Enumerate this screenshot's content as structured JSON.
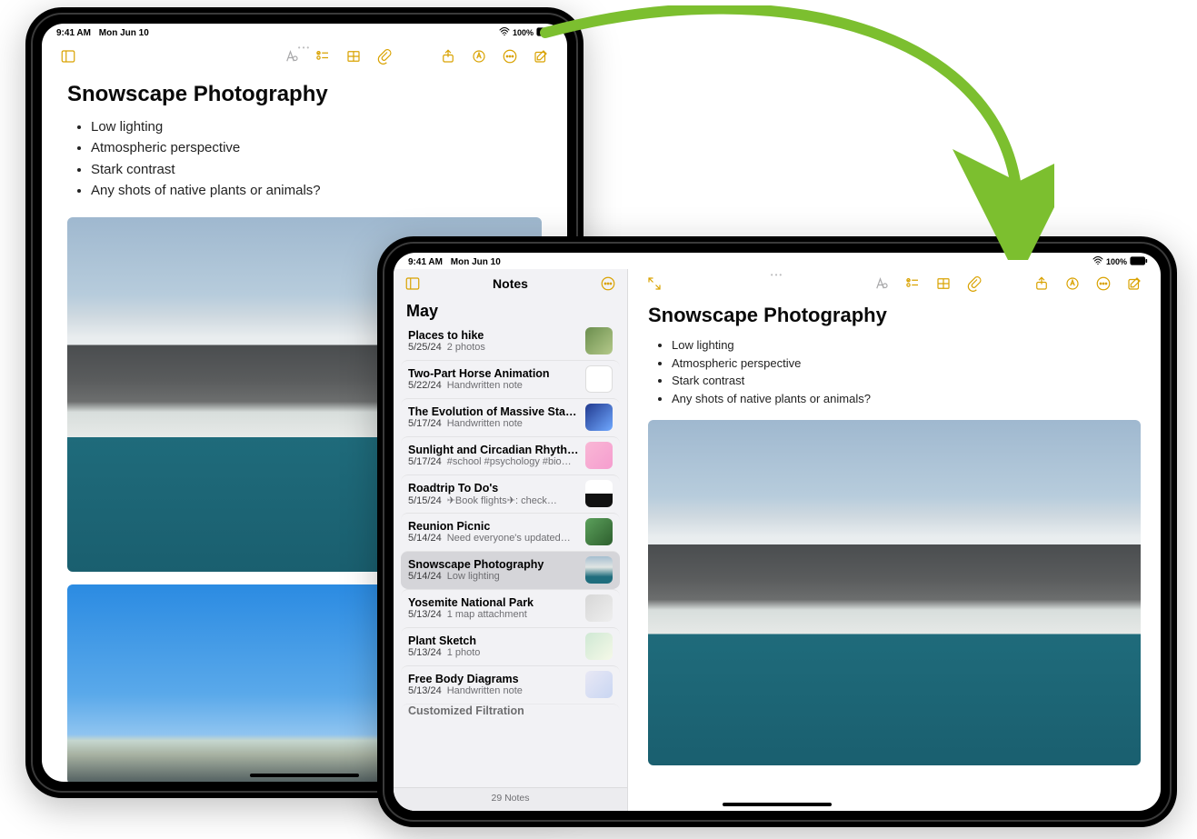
{
  "status": {
    "time": "9:41 AM",
    "date": "Mon Jun 10",
    "battery_percent": "100%"
  },
  "note": {
    "title": "Snowscape Photography",
    "bullets": [
      "Low lighting",
      "Atmospheric perspective",
      "Stark contrast",
      "Any shots of native plants or animals?"
    ]
  },
  "sidebar": {
    "header": "Notes",
    "section": "May",
    "items": [
      {
        "title": "Places to hike",
        "date": "5/25/24",
        "preview": "2 photos",
        "thumb": "c1"
      },
      {
        "title": "Two-Part Horse Animation",
        "date": "5/22/24",
        "preview": "Handwritten note",
        "thumb": "c2"
      },
      {
        "title": "The Evolution of Massive Star…",
        "date": "5/17/24",
        "preview": "Handwritten note",
        "thumb": "c3"
      },
      {
        "title": "Sunlight and Circadian Rhyth…",
        "date": "5/17/24",
        "preview": "#school #psychology #bio…",
        "thumb": "c4"
      },
      {
        "title": "Roadtrip To Do's",
        "date": "5/15/24",
        "preview": "✈︎Book flights✈︎: check…",
        "thumb": "c5"
      },
      {
        "title": "Reunion Picnic",
        "date": "5/14/24",
        "preview": "Need everyone's updated…",
        "thumb": "c6"
      },
      {
        "title": "Snowscape Photography",
        "date": "5/14/24",
        "preview": "Low lighting",
        "thumb": "c7",
        "selected": true
      },
      {
        "title": "Yosemite National Park",
        "date": "5/13/24",
        "preview": "1 map attachment",
        "thumb": "c8"
      },
      {
        "title": "Plant Sketch",
        "date": "5/13/24",
        "preview": "1 photo",
        "thumb": "c9"
      },
      {
        "title": "Free Body Diagrams",
        "date": "5/13/24",
        "preview": "Handwritten note",
        "thumb": "c10"
      }
    ],
    "partial_next": "Customized Filtration",
    "footer": "29 Notes"
  }
}
